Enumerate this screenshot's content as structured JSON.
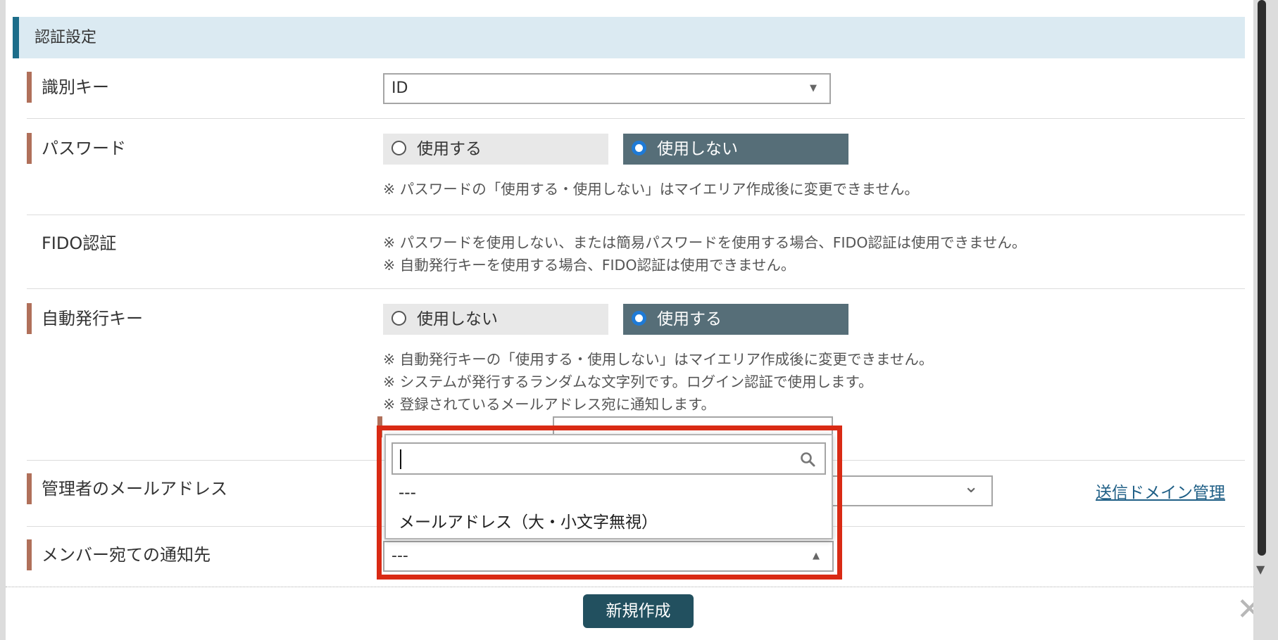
{
  "section": {
    "title": "認証設定"
  },
  "identifier_key": {
    "label": "識別キー",
    "value": "ID",
    "arrow": "▼"
  },
  "password": {
    "label": "パスワード",
    "option_use": "使用する",
    "option_nouse": "使用しない",
    "selected": "使用しない",
    "note": "※ パスワードの「使用する・使用しない」はマイエリア作成後に変更できません。"
  },
  "fido": {
    "label": "FIDO認証",
    "notes": [
      "※ パスワードを使用しない、または簡易パスワードを使用する場合、FIDO認証は使用できません。",
      "※ 自動発行キーを使用する場合、FIDO認証は使用できません。"
    ]
  },
  "auto_key": {
    "label": "自動発行キー",
    "option_nouse": "使用しない",
    "option_use": "使用する",
    "selected": "使用する",
    "notes": [
      "※ 自動発行キーの「使用する・使用しない」はマイエリア作成後に変更できません。",
      "※ システムが発行するランダムな文字列です。ログイン認証で使用します。",
      "※ 登録されているメールアドレス宛に通知します。"
    ]
  },
  "admin_email": {
    "label": "管理者のメールアドレス",
    "link": "送信ドメイン管理",
    "chevron": "⌄"
  },
  "member_notify": {
    "label": "メンバー宛ての通知先",
    "value": "---",
    "arrow": "▲"
  },
  "dropdown": {
    "search_placeholder": "",
    "options": [
      "---",
      "メールアドレス（大・小文字無視）"
    ]
  },
  "footer": {
    "create_button": "新規作成",
    "close": "✕"
  },
  "colors": {
    "section_bg": "#dbeaf2",
    "section_accent": "#1c6d8a",
    "label_marker": "#b0705a",
    "radio_selected_bg": "#566e78",
    "button_bg": "#22505f",
    "highlight": "#d92a14"
  }
}
